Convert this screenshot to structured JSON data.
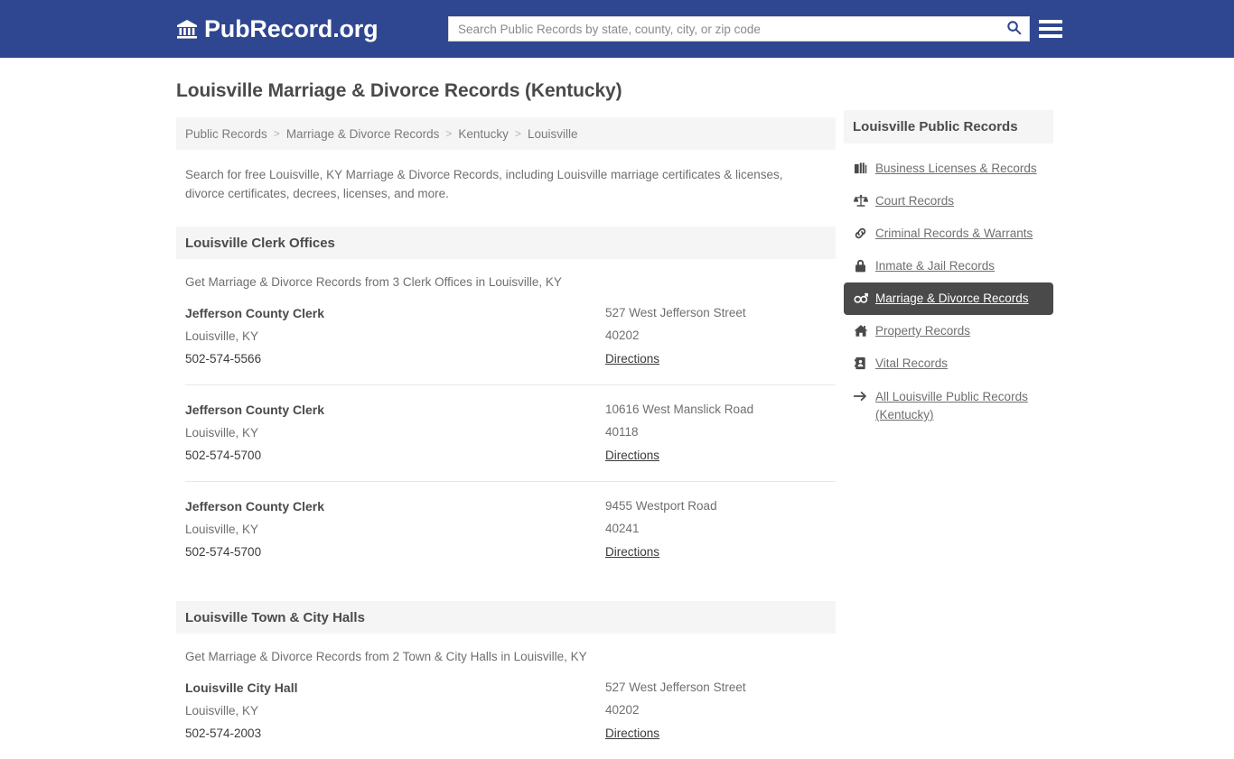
{
  "header": {
    "logo_text": "PubRecord.org",
    "logo_icon": "bank-building-icon",
    "search_placeholder": "Search Public Records by state, county, city, or zip code",
    "search_value": "",
    "search_icon": "search-icon",
    "menu_icon": "hamburger-menu-icon"
  },
  "main": {
    "title": "Louisville Marriage & Divorce Records (Kentucky)",
    "breadcrumb": [
      {
        "label": "Public Records",
        "current": false
      },
      {
        "label": "Marriage & Divorce Records",
        "current": false
      },
      {
        "label": "Kentucky",
        "current": false
      },
      {
        "label": "Louisville",
        "current": true
      }
    ],
    "breadcrumb_separator": ">",
    "intro": "Search for free Louisville, KY Marriage & Divorce Records, including Louisville marriage certificates & licenses, divorce certificates, decrees, licenses, and more.",
    "sections": [
      {
        "heading": "Louisville Clerk Offices",
        "subtext": "Get Marriage & Divorce Records from 3 Clerk Offices in Louisville, KY",
        "listings": [
          {
            "name": "Jefferson County Clerk",
            "citystate": "Louisville, KY",
            "phone": "502-574-5566",
            "street": "527 West Jefferson Street",
            "zip": "40202",
            "directions": "Directions"
          },
          {
            "name": "Jefferson County Clerk",
            "citystate": "Louisville, KY",
            "phone": "502-574-5700",
            "street": "10616 West Manslick Road",
            "zip": "40118",
            "directions": "Directions"
          },
          {
            "name": "Jefferson County Clerk",
            "citystate": "Louisville, KY",
            "phone": "502-574-5700",
            "street": "9455 Westport Road",
            "zip": "40241",
            "directions": "Directions"
          }
        ]
      },
      {
        "heading": "Louisville Town & City Halls",
        "subtext": "Get Marriage & Divorce Records from 2 Town & City Halls in Louisville, KY",
        "listings": [
          {
            "name": "Louisville City Hall",
            "citystate": "Louisville, KY",
            "phone": "502-574-2003",
            "street": "527 West Jefferson Street",
            "zip": "40202",
            "directions": "Directions"
          }
        ]
      }
    ]
  },
  "sidebar": {
    "heading": "Louisville Public Records",
    "items": [
      {
        "label": "Business Licenses & Records",
        "icon": "briefcase-icon",
        "active": false
      },
      {
        "label": "Court Records",
        "icon": "scales-of-justice-icon",
        "active": false
      },
      {
        "label": "Criminal Records & Warrants",
        "icon": "chain-link-icon",
        "active": false
      },
      {
        "label": "Inmate & Jail Records",
        "icon": "padlock-icon",
        "active": false
      },
      {
        "label": "Marriage & Divorce Records",
        "icon": "venus-mars-icon",
        "active": true
      },
      {
        "label": "Property Records",
        "icon": "home-icon",
        "active": false
      },
      {
        "label": "Vital Records",
        "icon": "address-book-icon",
        "active": false
      },
      {
        "label": "All Louisville Public Records (Kentucky)",
        "icon": "arrow-right-icon",
        "active": false
      }
    ]
  },
  "colors": {
    "header_blue": "#2f4690",
    "band_gray": "#f5f5f5",
    "active_dark": "#4a4a4a",
    "text_gray": "#6f6f6f"
  }
}
